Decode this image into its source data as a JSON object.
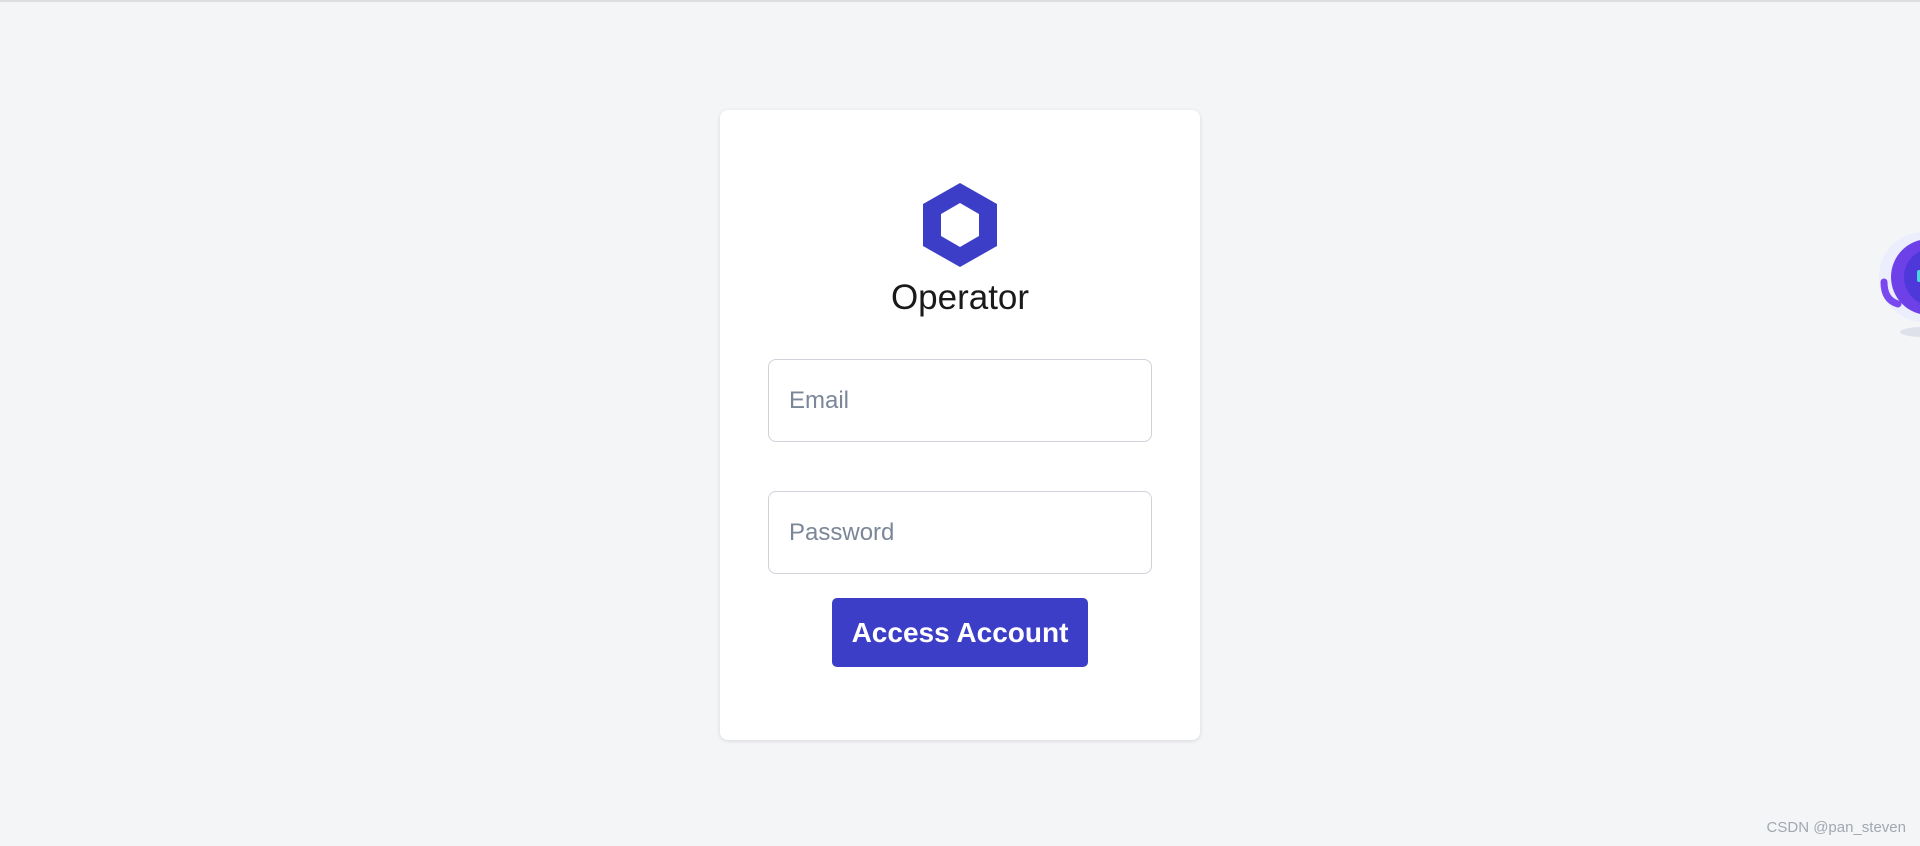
{
  "app": {
    "title": "Operator",
    "logo_icon": "hexagon-icon",
    "accent_color": "#3d3ec8"
  },
  "login": {
    "email_placeholder": "Email",
    "password_placeholder": "Password",
    "submit_label": "Access Account"
  },
  "overlay": {
    "assistant_icon": "assistant-bot-icon"
  },
  "watermark": {
    "text": "CSDN @pan_steven"
  }
}
